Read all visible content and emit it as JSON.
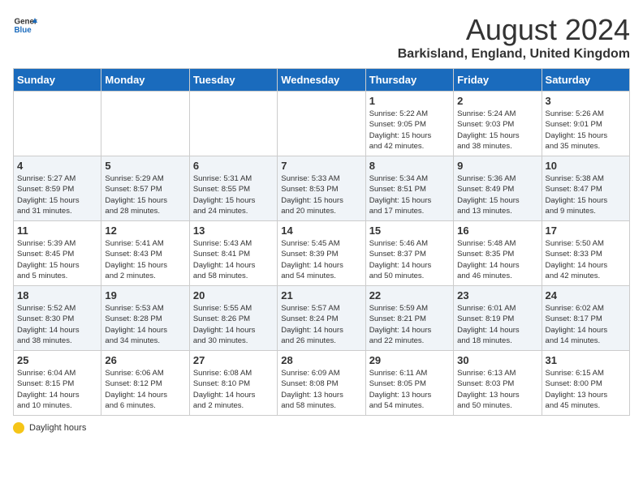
{
  "header": {
    "logo_general": "General",
    "logo_blue": "Blue",
    "title": "August 2024",
    "subtitle": "Barkisland, England, United Kingdom"
  },
  "days_of_week": [
    "Sunday",
    "Monday",
    "Tuesday",
    "Wednesday",
    "Thursday",
    "Friday",
    "Saturday"
  ],
  "weeks": [
    [
      {
        "day": "",
        "info": ""
      },
      {
        "day": "",
        "info": ""
      },
      {
        "day": "",
        "info": ""
      },
      {
        "day": "",
        "info": ""
      },
      {
        "day": "1",
        "info": "Sunrise: 5:22 AM\nSunset: 9:05 PM\nDaylight: 15 hours\nand 42 minutes."
      },
      {
        "day": "2",
        "info": "Sunrise: 5:24 AM\nSunset: 9:03 PM\nDaylight: 15 hours\nand 38 minutes."
      },
      {
        "day": "3",
        "info": "Sunrise: 5:26 AM\nSunset: 9:01 PM\nDaylight: 15 hours\nand 35 minutes."
      }
    ],
    [
      {
        "day": "4",
        "info": "Sunrise: 5:27 AM\nSunset: 8:59 PM\nDaylight: 15 hours\nand 31 minutes."
      },
      {
        "day": "5",
        "info": "Sunrise: 5:29 AM\nSunset: 8:57 PM\nDaylight: 15 hours\nand 28 minutes."
      },
      {
        "day": "6",
        "info": "Sunrise: 5:31 AM\nSunset: 8:55 PM\nDaylight: 15 hours\nand 24 minutes."
      },
      {
        "day": "7",
        "info": "Sunrise: 5:33 AM\nSunset: 8:53 PM\nDaylight: 15 hours\nand 20 minutes."
      },
      {
        "day": "8",
        "info": "Sunrise: 5:34 AM\nSunset: 8:51 PM\nDaylight: 15 hours\nand 17 minutes."
      },
      {
        "day": "9",
        "info": "Sunrise: 5:36 AM\nSunset: 8:49 PM\nDaylight: 15 hours\nand 13 minutes."
      },
      {
        "day": "10",
        "info": "Sunrise: 5:38 AM\nSunset: 8:47 PM\nDaylight: 15 hours\nand 9 minutes."
      }
    ],
    [
      {
        "day": "11",
        "info": "Sunrise: 5:39 AM\nSunset: 8:45 PM\nDaylight: 15 hours\nand 5 minutes."
      },
      {
        "day": "12",
        "info": "Sunrise: 5:41 AM\nSunset: 8:43 PM\nDaylight: 15 hours\nand 2 minutes."
      },
      {
        "day": "13",
        "info": "Sunrise: 5:43 AM\nSunset: 8:41 PM\nDaylight: 14 hours\nand 58 minutes."
      },
      {
        "day": "14",
        "info": "Sunrise: 5:45 AM\nSunset: 8:39 PM\nDaylight: 14 hours\nand 54 minutes."
      },
      {
        "day": "15",
        "info": "Sunrise: 5:46 AM\nSunset: 8:37 PM\nDaylight: 14 hours\nand 50 minutes."
      },
      {
        "day": "16",
        "info": "Sunrise: 5:48 AM\nSunset: 8:35 PM\nDaylight: 14 hours\nand 46 minutes."
      },
      {
        "day": "17",
        "info": "Sunrise: 5:50 AM\nSunset: 8:33 PM\nDaylight: 14 hours\nand 42 minutes."
      }
    ],
    [
      {
        "day": "18",
        "info": "Sunrise: 5:52 AM\nSunset: 8:30 PM\nDaylight: 14 hours\nand 38 minutes."
      },
      {
        "day": "19",
        "info": "Sunrise: 5:53 AM\nSunset: 8:28 PM\nDaylight: 14 hours\nand 34 minutes."
      },
      {
        "day": "20",
        "info": "Sunrise: 5:55 AM\nSunset: 8:26 PM\nDaylight: 14 hours\nand 30 minutes."
      },
      {
        "day": "21",
        "info": "Sunrise: 5:57 AM\nSunset: 8:24 PM\nDaylight: 14 hours\nand 26 minutes."
      },
      {
        "day": "22",
        "info": "Sunrise: 5:59 AM\nSunset: 8:21 PM\nDaylight: 14 hours\nand 22 minutes."
      },
      {
        "day": "23",
        "info": "Sunrise: 6:01 AM\nSunset: 8:19 PM\nDaylight: 14 hours\nand 18 minutes."
      },
      {
        "day": "24",
        "info": "Sunrise: 6:02 AM\nSunset: 8:17 PM\nDaylight: 14 hours\nand 14 minutes."
      }
    ],
    [
      {
        "day": "25",
        "info": "Sunrise: 6:04 AM\nSunset: 8:15 PM\nDaylight: 14 hours\nand 10 minutes."
      },
      {
        "day": "26",
        "info": "Sunrise: 6:06 AM\nSunset: 8:12 PM\nDaylight: 14 hours\nand 6 minutes."
      },
      {
        "day": "27",
        "info": "Sunrise: 6:08 AM\nSunset: 8:10 PM\nDaylight: 14 hours\nand 2 minutes."
      },
      {
        "day": "28",
        "info": "Sunrise: 6:09 AM\nSunset: 8:08 PM\nDaylight: 13 hours\nand 58 minutes."
      },
      {
        "day": "29",
        "info": "Sunrise: 6:11 AM\nSunset: 8:05 PM\nDaylight: 13 hours\nand 54 minutes."
      },
      {
        "day": "30",
        "info": "Sunrise: 6:13 AM\nSunset: 8:03 PM\nDaylight: 13 hours\nand 50 minutes."
      },
      {
        "day": "31",
        "info": "Sunrise: 6:15 AM\nSunset: 8:00 PM\nDaylight: 13 hours\nand 45 minutes."
      }
    ]
  ],
  "legend": {
    "label": "Daylight hours"
  }
}
